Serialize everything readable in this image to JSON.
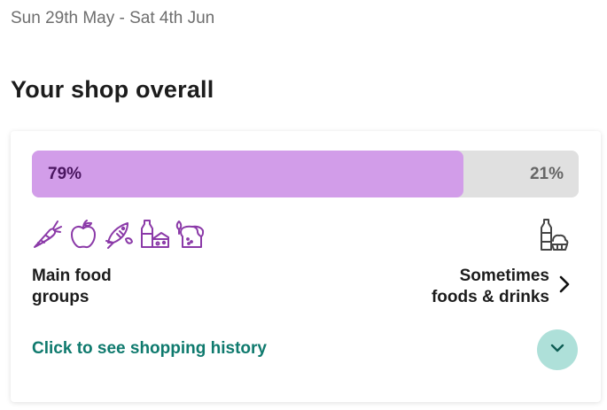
{
  "header": {
    "date_range": "Sun 29th May - Sat 4th Jun",
    "section_title": "Your shop overall"
  },
  "summary": {
    "main_food_groups": {
      "percent": 79,
      "percent_label": "79%",
      "label_line1": "Main food",
      "label_line2": "groups",
      "icons": [
        "carrot-icon",
        "apple-icon",
        "fish-icon",
        "milk-cheese-icon",
        "bread-icon"
      ]
    },
    "sometimes_foods": {
      "percent": 21,
      "percent_label": "21%",
      "label_line1": "Sometimes",
      "label_line2": "foods & drinks",
      "icons": [
        "bottle-cupcake-icon",
        "chevron-right-icon"
      ]
    }
  },
  "actions": {
    "history_link": "Click to see shopping history",
    "expand_icon": "chevron-down-icon"
  },
  "colors": {
    "main_bar": "#d29de9",
    "main_text": "#4a1660",
    "sometimes_bar": "#e0e0e0",
    "sometimes_text": "#666666",
    "icon_stroke": "#8b3aa8",
    "link": "#0f7a6e",
    "expand_bg": "#aee0d9",
    "expand_icon": "#0f5e55"
  }
}
